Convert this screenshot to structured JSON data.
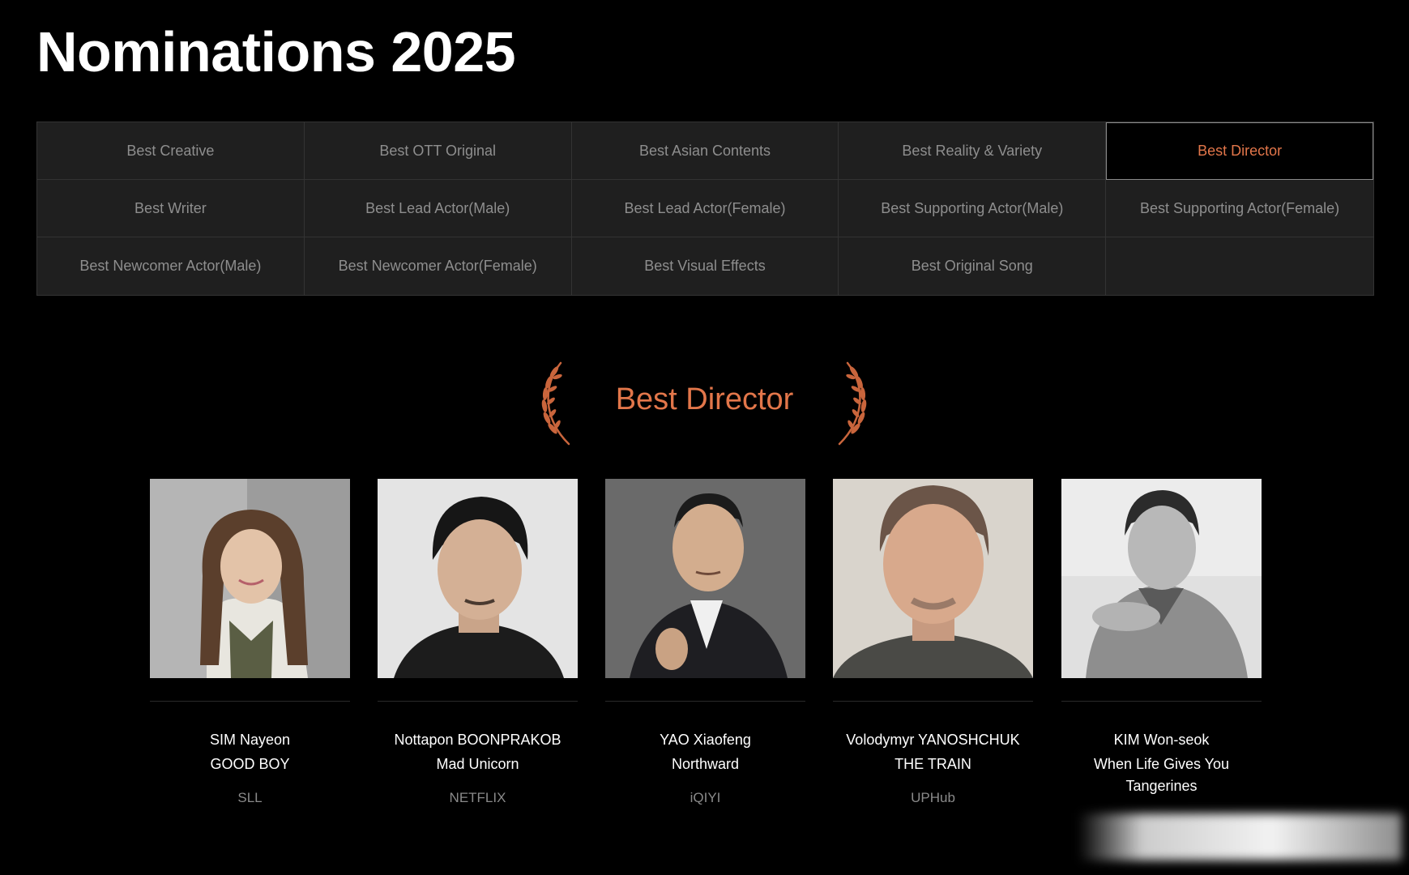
{
  "page": {
    "title": "Nominations 2025"
  },
  "categories": [
    {
      "label": "Best Creative",
      "active": false
    },
    {
      "label": "Best OTT Original",
      "active": false
    },
    {
      "label": "Best Asian Contents",
      "active": false
    },
    {
      "label": "Best Reality & Variety",
      "active": false
    },
    {
      "label": "Best Director",
      "active": true
    },
    {
      "label": "Best Writer",
      "active": false
    },
    {
      "label": "Best Lead Actor(Male)",
      "active": false
    },
    {
      "label": "Best Lead Actor(Female)",
      "active": false
    },
    {
      "label": "Best Supporting Actor(Male)",
      "active": false
    },
    {
      "label": "Best Supporting Actor(Female)",
      "active": false
    },
    {
      "label": "Best Newcomer Actor(Male)",
      "active": false
    },
    {
      "label": "Best Newcomer Actor(Female)",
      "active": false
    },
    {
      "label": "Best Visual Effects",
      "active": false
    },
    {
      "label": "Best Original Song",
      "active": false
    },
    {
      "label": "",
      "active": false
    }
  ],
  "section": {
    "title": "Best Director",
    "laurel_icon": "laurel-wreath-icon"
  },
  "nominees": [
    {
      "name": "SIM Nayeon",
      "work": "GOOD BOY",
      "platform": "SLL"
    },
    {
      "name": "Nottapon BOONPRAKOB",
      "work": "Mad Unicorn",
      "platform": "NETFLIX"
    },
    {
      "name": "YAO Xiaofeng",
      "work": "Northward",
      "platform": "iQIYI"
    },
    {
      "name": "Volodymyr YANOSHCHUK",
      "work": "THE TRAIN",
      "platform": "UPHub"
    },
    {
      "name": "KIM Won-seok",
      "work": "When Life Gives You Tangerines",
      "platform": ""
    }
  ],
  "colors": {
    "accent": "#e2764a",
    "background": "#000000",
    "grid_background": "#1f1f1f",
    "muted_text": "#8e8e8e"
  }
}
